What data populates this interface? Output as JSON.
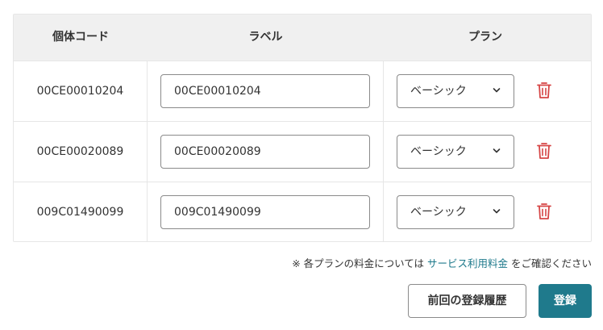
{
  "table": {
    "headers": {
      "code": "個体コード",
      "label": "ラベル",
      "plan": "プラン"
    },
    "rows": [
      {
        "code": "00CE00010204",
        "label_value": "00CE00010204",
        "plan": "ベーシック"
      },
      {
        "code": "00CE00020089",
        "label_value": "00CE00020089",
        "plan": "ベーシック"
      },
      {
        "code": "009C01490099",
        "label_value": "009C01490099",
        "plan": "ベーシック"
      }
    ]
  },
  "note": {
    "prefix": "※ 各プランの料金については ",
    "link": "サービス利用料金",
    "suffix": " をご確認ください"
  },
  "actions": {
    "history_label": "前回の登録履歴",
    "register_label": "登録"
  },
  "icons": {
    "delete": "trash-icon",
    "select": "chevron-down-icon"
  },
  "colors": {
    "accent": "#1f7a8c",
    "danger": "#d64545",
    "header_bg": "#f0f0f0"
  }
}
